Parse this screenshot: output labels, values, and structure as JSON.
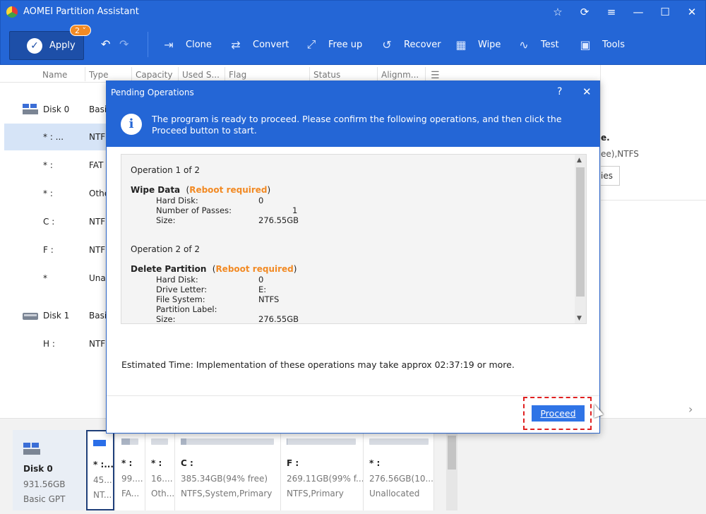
{
  "app": {
    "title": "AOMEI Partition Assistant"
  },
  "toolbar": {
    "apply_label": "Apply",
    "pending_count": "2",
    "tools": [
      {
        "label": "Clone",
        "icon": "clone-icon"
      },
      {
        "label": "Convert",
        "icon": "convert-icon"
      },
      {
        "label": "Free up",
        "icon": "free-up-icon"
      },
      {
        "label": "Recover",
        "icon": "recover-icon"
      },
      {
        "label": "Wipe",
        "icon": "wipe-icon"
      },
      {
        "label": "Test",
        "icon": "test-icon"
      },
      {
        "label": "Tools",
        "icon": "tools-icon"
      }
    ]
  },
  "table": {
    "columns": [
      "Name",
      "Type",
      "Capacity",
      "Used S...",
      "Flag",
      "Status",
      "Alignm..."
    ],
    "rows": [
      {
        "name": "Disk 0",
        "type": "Basi",
        "kind": "disk"
      },
      {
        "name": "* : ...",
        "type": "NTF",
        "kind": "part",
        "selected": true
      },
      {
        "name": "* :",
        "type": "FAT",
        "kind": "part"
      },
      {
        "name": "* :",
        "type": "Othe",
        "kind": "part"
      },
      {
        "name": "C :",
        "type": "NTF",
        "kind": "part"
      },
      {
        "name": "F :",
        "type": "NTF",
        "kind": "part"
      },
      {
        "name": "*",
        "type": "Unal",
        "kind": "part"
      },
      {
        "name": "Disk 1",
        "type": "Basi",
        "kind": "disk"
      },
      {
        "name": "H :",
        "type": "NTF",
        "kind": "part"
      }
    ]
  },
  "right_pane": {
    "title_fragment": "e.",
    "fs_fragment": "ee),NTFS",
    "button_fragment": "ies"
  },
  "disk_map": {
    "disk": {
      "name": "Disk 0",
      "size": "931.56GB",
      "type": "Basic GPT"
    },
    "partitions": [
      {
        "label": "* :...",
        "size": "45...",
        "type": "NT...",
        "used": 1.0,
        "selected": true
      },
      {
        "label": "* :",
        "size": "99....",
        "type": "FA...",
        "used": 0.5
      },
      {
        "label": "* :",
        "size": "16....",
        "type": "Oth...",
        "used": 0.0
      },
      {
        "label": "C :",
        "size": "385.34GB(94% free)",
        "type": "NTFS,System,Primary",
        "used": 0.06
      },
      {
        "label": "F :",
        "size": "269.11GB(99% f...",
        "type": "NTFS,Primary",
        "used": 0.01
      },
      {
        "label": "* :",
        "size": "276.56GB(10...",
        "type": "Unallocated",
        "used": 0.0
      }
    ]
  },
  "dialog": {
    "title": "Pending Operations",
    "help": "?",
    "close": "✕",
    "banner": "The program is ready to proceed. Please confirm the following operations, and then click the Proceed button to start.",
    "operations": [
      {
        "header": "Operation 1 of 2",
        "name": "Wipe Data",
        "note": "Reboot required",
        "details": [
          {
            "k": "Hard Disk:",
            "v": "0"
          },
          {
            "k": "Number of Passes:",
            "v": "1",
            "right": true
          },
          {
            "k": "Size:",
            "v": "276.55GB"
          }
        ]
      },
      {
        "header": "Operation 2 of 2",
        "name": "Delete Partition",
        "note": "Reboot required",
        "details": [
          {
            "k": "Hard Disk:",
            "v": "0"
          },
          {
            "k": "Drive Letter:",
            "v": "E:"
          },
          {
            "k": "File System:",
            "v": "NTFS"
          },
          {
            "k": "Partition Label:",
            "v": ""
          },
          {
            "k": "Size:",
            "v": "276.55GB"
          }
        ]
      }
    ],
    "estimate": "Estimated Time: Implementation of these operations may take approx 02:37:19 or more.",
    "proceed_label": "Proceed"
  }
}
